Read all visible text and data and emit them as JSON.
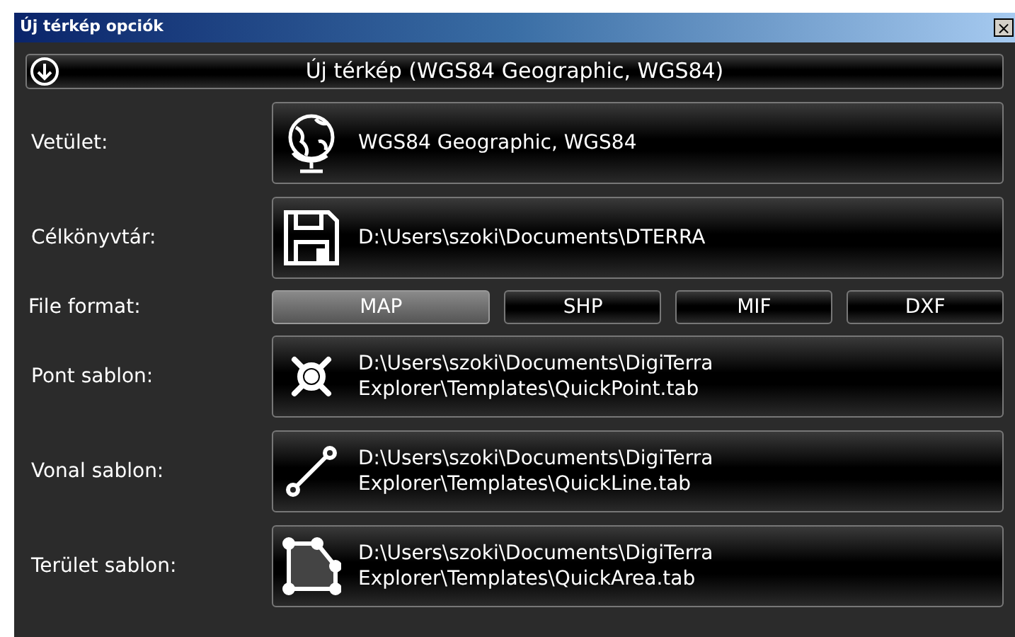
{
  "window": {
    "title": "Új térkép opciók",
    "close": "×"
  },
  "header": {
    "title": "Új térkép (WGS84 Geographic, WGS84)"
  },
  "rows": [
    {
      "kind": "globe",
      "label": "Vetület:",
      "lines": [
        "WGS84 Geographic, WGS84"
      ]
    },
    {
      "kind": "floppy",
      "label": "Célkönyvtár:",
      "lines": [
        "D:\\Users\\szoki\\Documents\\DTERRA"
      ]
    },
    {
      "kind": "format",
      "label": "File format:",
      "options": [
        {
          "label": "MAP",
          "selected": true
        },
        {
          "label": "SHP",
          "selected": false
        },
        {
          "label": "MIF",
          "selected": false
        },
        {
          "label": "DXF",
          "selected": false
        }
      ]
    },
    {
      "kind": "point",
      "label": "Pont sablon:",
      "lines": [
        "D:\\Users\\szoki\\Documents\\DigiTerra",
        "Explorer\\Templates\\QuickPoint.tab"
      ]
    },
    {
      "kind": "line",
      "label": "Vonal sablon:",
      "lines": [
        "D:\\Users\\szoki\\Documents\\DigiTerra",
        "Explorer\\Templates\\QuickLine.tab"
      ]
    },
    {
      "kind": "area",
      "label": "Terület sablon:",
      "lines": [
        "D:\\Users\\szoki\\Documents\\DigiTerra",
        "Explorer\\Templates\\QuickArea.tab"
      ]
    }
  ]
}
